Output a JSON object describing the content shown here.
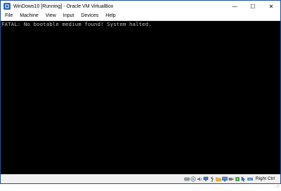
{
  "window": {
    "title": "WinDows10 [Running] - Oracle VM VirtualBox"
  },
  "title_controls": {
    "minimize": "—",
    "maximize": "☐",
    "close": "✕"
  },
  "menu": [
    {
      "label": "File"
    },
    {
      "label": "Machine"
    },
    {
      "label": "View"
    },
    {
      "label": "Input"
    },
    {
      "label": "Devices"
    },
    {
      "label": "Help"
    }
  ],
  "console": {
    "text": "FATAL: No bootable medium found! System halted."
  },
  "status": {
    "icons": [
      "hard-disk-icon",
      "optical-drive-icon",
      "audio-icon",
      "network-icon",
      "usb-icon",
      "shared-folders-icon",
      "display-icon",
      "video-capture-icon",
      "cpu-icon",
      "mouse-integration-icon",
      "keyboard-capture-icon"
    ],
    "host_key": "Right Ctrl"
  },
  "colors": {
    "console_bg": "#000000",
    "console_text": "#c0c0c0",
    "accent": "#1e4f9c"
  }
}
